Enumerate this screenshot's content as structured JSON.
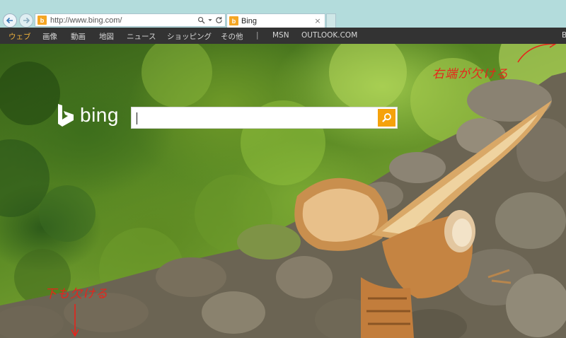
{
  "browser": {
    "url": "http://www.bing.com/",
    "tab_title": "Bing",
    "tab_close": "×",
    "favicon_letter": "b"
  },
  "nav": {
    "items": [
      "ウェブ",
      "画像",
      "動画",
      "地図",
      "ニュース",
      "ショッピング",
      "その他",
      "|",
      "MSN",
      "OUTLOOK.COM"
    ],
    "active_index": 0,
    "cut_off_right": "B"
  },
  "brand": {
    "logo_text": "bing"
  },
  "search": {
    "value": "",
    "placeholder": ""
  },
  "annotations": {
    "right_edge_note": "右端が欠ける",
    "bottom_edge_note": "下も欠ける"
  },
  "colors": {
    "chrome": "#b3dcdc",
    "nav_bg": "#333333",
    "nav_active": "#f0b23c",
    "search_button": "#f5a20c",
    "annotation": "#e8231b"
  },
  "icons": [
    "back-arrow-icon",
    "forward-arrow-icon",
    "bing-favicon-icon",
    "search-icon",
    "dropdown-arrow-icon",
    "refresh-icon",
    "close-icon",
    "bing-logo-icon"
  ]
}
